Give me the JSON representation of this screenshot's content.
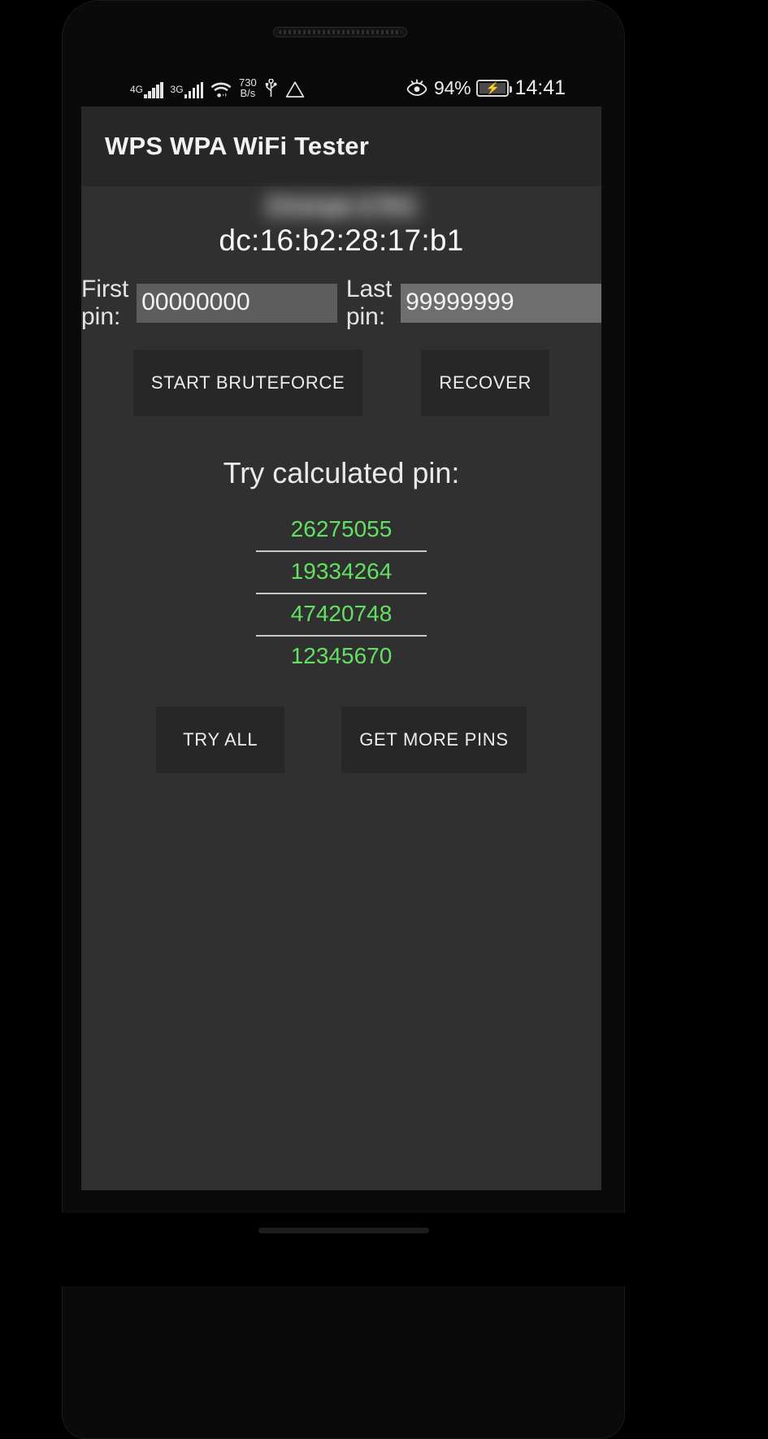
{
  "statusbar": {
    "net1_label": "4G",
    "net2_label": "3G",
    "wifi_icon": "wifi-icon",
    "speed_value": "730",
    "speed_unit": "B/s",
    "usb_icon": "usb-icon",
    "warning_icon": "warning-triangle-icon",
    "eye_icon": "eye-comfort-icon",
    "battery_percent": "94%",
    "battery_icon": "battery-charging-icon",
    "time": "14:41"
  },
  "appbar": {
    "title": "WPS WPA WiFi Tester"
  },
  "network": {
    "ssid_redacted": "Orange-1781",
    "mac_address": "dc:16:b2:28:17:b1"
  },
  "bruteforce": {
    "first_pin_label": "First pin:",
    "first_pin_value": "00000000",
    "last_pin_label": "Last pin:",
    "last_pin_value": "99999999",
    "start_button": "START BRUTEFORCE",
    "recover_button": "RECOVER"
  },
  "calculated": {
    "title": "Try calculated pin:",
    "pins": [
      "26275055",
      "19334264",
      "47420748",
      "12345670"
    ],
    "try_all_button": "TRY ALL",
    "get_more_button": "GET MORE PINS"
  },
  "colors": {
    "pin_green": "#63e063",
    "app_background": "#303030",
    "appbar_background": "#272727"
  }
}
